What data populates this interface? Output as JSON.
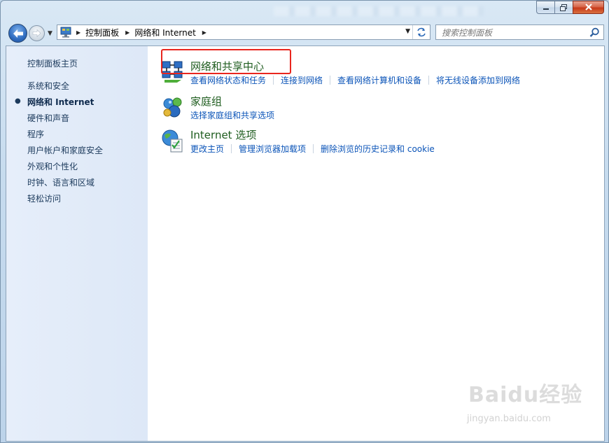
{
  "window": {
    "caption_buttons": [
      "minimize",
      "maximize",
      "close"
    ]
  },
  "address_bar": {
    "crumbs": [
      "控制面板",
      "网络和 Internet"
    ]
  },
  "search": {
    "placeholder": "搜索控制面板"
  },
  "sidebar": {
    "items": [
      {
        "label": "控制面板主页",
        "active": false
      },
      {
        "label": "系统和安全",
        "active": false
      },
      {
        "label": "网络和 Internet",
        "active": true
      },
      {
        "label": "硬件和声音",
        "active": false
      },
      {
        "label": "程序",
        "active": false
      },
      {
        "label": "用户帐户和家庭安全",
        "active": false
      },
      {
        "label": "外观和个性化",
        "active": false
      },
      {
        "label": "时钟、语言和区域",
        "active": false
      },
      {
        "label": "轻松访问",
        "active": false
      }
    ]
  },
  "categories": [
    {
      "title": "网络和共享中心",
      "icon": "network-sharing-center-icon",
      "links": [
        "查看网络状态和任务",
        "连接到网络",
        "查看网络计算机和设备",
        "将无线设备添加到网络"
      ],
      "highlighted": true
    },
    {
      "title": "家庭组",
      "icon": "homegroup-icon",
      "links": [
        "选择家庭组和共享选项"
      ]
    },
    {
      "title": "Internet 选项",
      "icon": "internet-options-icon",
      "links": [
        "更改主页",
        "管理浏览器加载项",
        "删除浏览的历史记录和 cookie"
      ]
    }
  ],
  "watermark": {
    "logo": "Baidu经验",
    "url": "jingyan.baidu.com"
  },
  "colors": {
    "link": "#0b54b8",
    "category_title": "#1e5c1e",
    "highlight_box": "#e8261e",
    "sidebar_bg": "#e6eefa"
  }
}
